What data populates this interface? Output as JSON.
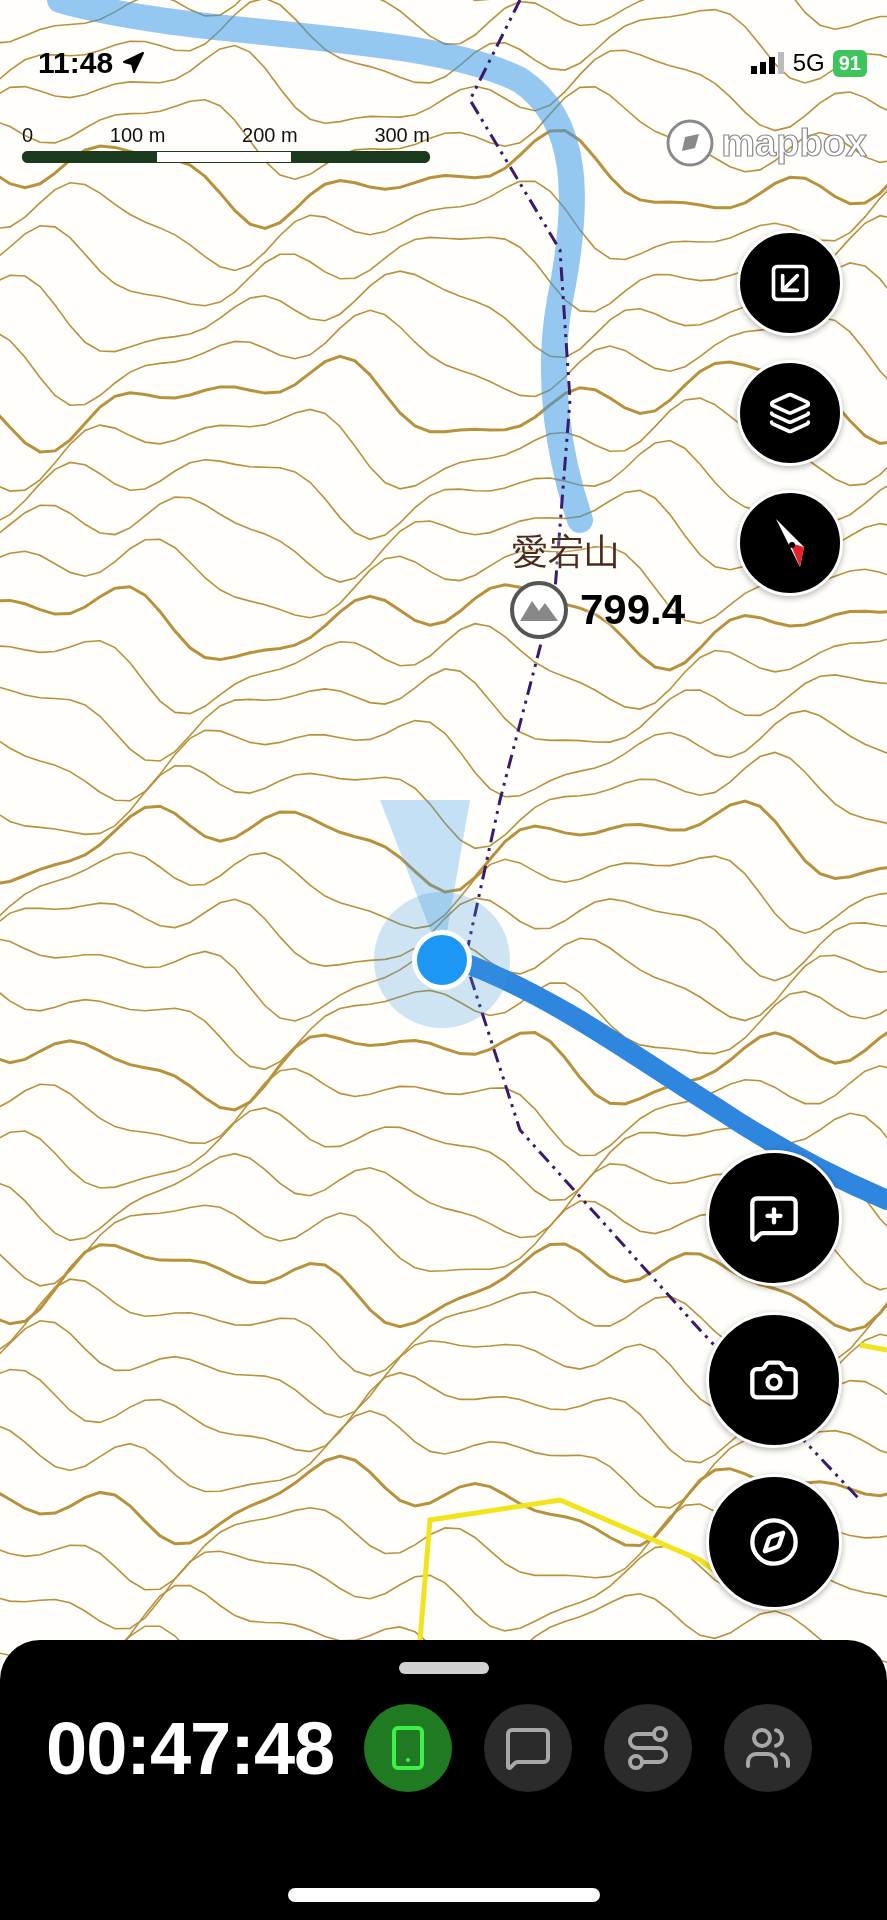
{
  "status_bar": {
    "time": "11:48",
    "network": "5G",
    "battery": "91"
  },
  "scale_bar": {
    "labels": [
      "0",
      "100 m",
      "200 m",
      "300 m"
    ]
  },
  "map": {
    "attribution": "mapbox",
    "peak": {
      "name": "愛宕山",
      "elevation": "799.4"
    }
  },
  "map_buttons": [
    {
      "kind": "fit"
    },
    {
      "kind": "layers"
    },
    {
      "kind": "north"
    }
  ],
  "action_buttons": [
    {
      "kind": "note"
    },
    {
      "kind": "camera"
    },
    {
      "kind": "compass"
    }
  ],
  "tracking": {
    "elapsed": "00:47:48"
  },
  "toolbar": [
    {
      "kind": "sharing",
      "on": true
    },
    {
      "kind": "message",
      "on": false
    },
    {
      "kind": "route",
      "on": false
    },
    {
      "kind": "group",
      "on": false
    }
  ]
}
